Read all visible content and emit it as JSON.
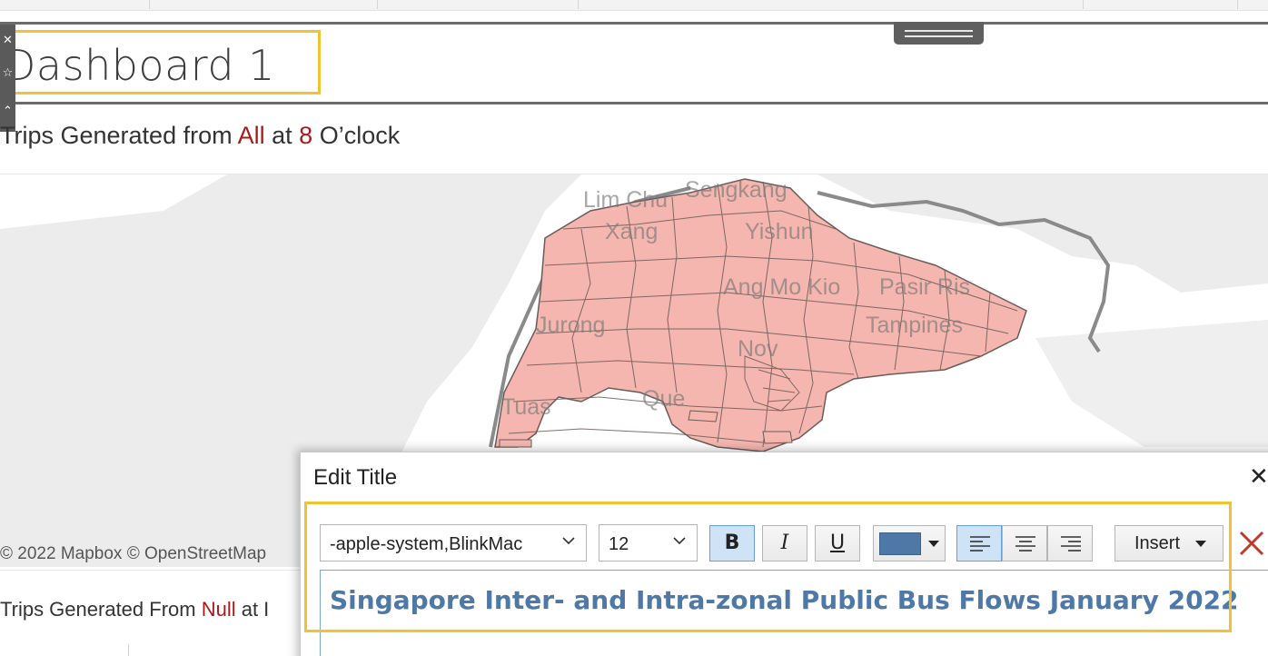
{
  "dashboard": {
    "title": "Dashboard 1"
  },
  "left_toolbar": {
    "icons": [
      "close-icon",
      "pin-icon",
      "more-icon"
    ]
  },
  "worksheet1": {
    "title_prefix": "Trips Generated from ",
    "origin": "All",
    "mid": " at ",
    "hour": "8",
    "suffix": " O’clock"
  },
  "map": {
    "labels": {
      "lim_chu_kang": "Lim Chu",
      "sengkang": "Sengkang",
      "kranji": "Xang",
      "yishun": "Yishun",
      "ang_mo_kio": "Ang Mo Kio",
      "pasir_ris": "Pasir Ris",
      "jurong": "Jurong",
      "tampines": "Tampines",
      "novena": "Nov",
      "queenstown": "Que",
      "tuas": "Tuas"
    },
    "region_fill": "#f4b6ae",
    "attribution": "© 2022 Mapbox © OpenStreetMap"
  },
  "worksheet2": {
    "title_prefix": "Trips Generated From ",
    "origin": "Null",
    "mid": " at I"
  },
  "edit_title_dialog": {
    "title": "Edit Title",
    "close_glyph": "✕",
    "font_family_value": "-apple-system,BlinkMac",
    "font_size_value": "12",
    "bold_label": "B",
    "italic_label": "I",
    "underline_label": "U",
    "text_color": "#4e79a7",
    "insert_label": "Insert",
    "editor_text": "Singapore Inter- and Intra-zonal Public Bus Flows January 2022"
  },
  "colors": {
    "highlight_border": "#f1c232",
    "accent_red": "#aa1a1a",
    "toolbar_dark": "#5a5a5a"
  }
}
